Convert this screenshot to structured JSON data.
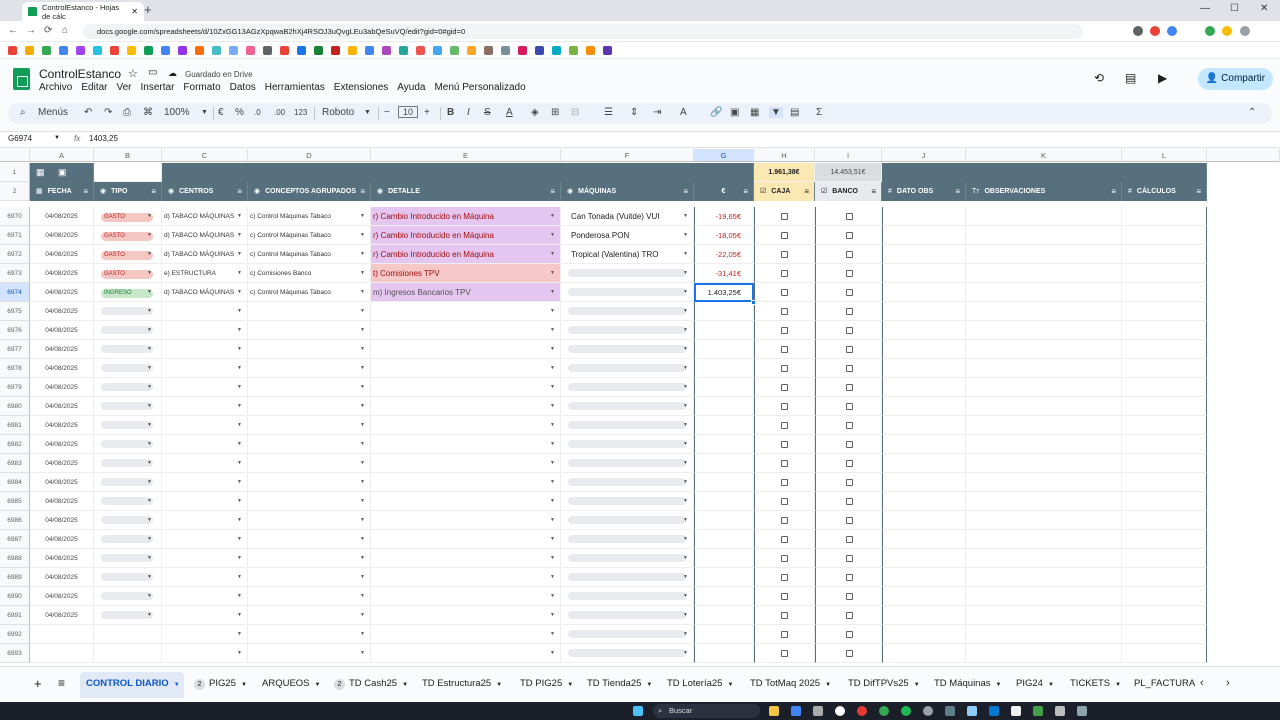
{
  "browser": {
    "tab_title": "ControlEstanco - Hojas de cálc",
    "url": "docs.google.com/spreadsheets/d/10ZxGG13AGzXpqwaB2hXj4RSOJ3uQvgLEu3abQeSuVQ/edit?gid=0#gid=0"
  },
  "app": {
    "title": "ControlEstanco",
    "saved_status": "Guardado en Drive",
    "menus": [
      "Archivo",
      "Editar",
      "Ver",
      "Insertar",
      "Formato",
      "Datos",
      "Herramientas",
      "Extensiones",
      "Ayuda",
      "Menú Personalizado"
    ],
    "share_label": "Compartir"
  },
  "toolbar": {
    "menus_label": "Menús",
    "zoom": "100%",
    "currency": "€",
    "percent": "%",
    "dec_less": ".0",
    "dec_more": ".00",
    "number_format": "123",
    "font": "Roboto",
    "font_size": "10"
  },
  "formula_bar": {
    "name_box": "G6974",
    "fx": "fx",
    "value": "1403,25"
  },
  "columns": [
    "A",
    "B",
    "C",
    "D",
    "E",
    "F",
    "G",
    "H",
    "I",
    "J",
    "K",
    "L"
  ],
  "row1": {
    "caja_total": "1.961,38€",
    "banco_total": "14.453,51€"
  },
  "headers": {
    "fecha": "FECHA",
    "tipo": "TIPO",
    "centros": "CENTROS",
    "conceptos": "CONCEPTOS AGRUPADOS",
    "detalle": "DETALLE",
    "maquinas": "MÁQUINAS",
    "euro": "€",
    "caja": "CAJA",
    "banco": "BANCO",
    "dato_obs": "DATO OBS",
    "observaciones": "OBSERVACIONES",
    "calculos": "CÁLCULOS"
  },
  "rows": [
    {
      "n": "6970",
      "fecha": "04/08/2025",
      "tipo": "GASTO",
      "centro": "d) TABACO MÁQUINAS",
      "concepto": "c) Control Máquinas Tabaco",
      "detalle": "r) Cambio Introducido en Máquina",
      "maquina": "Can Tonada (Vuitde) VUI",
      "importe": "-19,65€"
    },
    {
      "n": "6971",
      "fecha": "04/08/2025",
      "tipo": "GASTO",
      "centro": "d) TABACO MÁQUINAS",
      "concepto": "c) Control Máquinas Tabaco",
      "detalle": "r) Cambio Introducido en Máquina",
      "maquina": "Ponderosa PON",
      "importe": "-18,05€"
    },
    {
      "n": "6972",
      "fecha": "04/08/2025",
      "tipo": "GASTO",
      "centro": "d) TABACO MÁQUINAS",
      "concepto": "c) Control Máquinas Tabaco",
      "detalle": "r) Cambio Introducido en Máquina",
      "maquina": "Tropical (Valentina) TRO",
      "importe": "-22,05€"
    },
    {
      "n": "6973",
      "fecha": "04/08/2025",
      "tipo": "GASTO",
      "centro": "e) ESTRUCTURA",
      "concepto": "c) Comisiones Banco",
      "detalle": "t) Comisiones TPV",
      "maquina": "",
      "importe": "-31,41€"
    },
    {
      "n": "6974",
      "fecha": "04/08/2025",
      "tipo": "INGRESO",
      "centro": "d) TABACO MÁQUINAS",
      "concepto": "c) Control Máquinas Tabaco",
      "detalle": "m) Ingresos Bancarios TPV",
      "maquina": "",
      "importe": "1.403,25€"
    },
    {
      "n": "6975",
      "fecha": "04/08/2025"
    },
    {
      "n": "6976",
      "fecha": "04/08/2025"
    },
    {
      "n": "6977",
      "fecha": "04/08/2025"
    },
    {
      "n": "6978",
      "fecha": "04/08/2025"
    },
    {
      "n": "6979",
      "fecha": "04/08/2025"
    },
    {
      "n": "6980",
      "fecha": "04/08/2025"
    },
    {
      "n": "6981",
      "fecha": "04/08/2025"
    },
    {
      "n": "6982",
      "fecha": "04/08/2025"
    },
    {
      "n": "6983",
      "fecha": "04/08/2025"
    },
    {
      "n": "6984",
      "fecha": "04/08/2025"
    },
    {
      "n": "6985",
      "fecha": "04/08/2025"
    },
    {
      "n": "6986",
      "fecha": "04/08/2025"
    },
    {
      "n": "6987",
      "fecha": "04/08/2025"
    },
    {
      "n": "6988",
      "fecha": "04/08/2025"
    },
    {
      "n": "6989",
      "fecha": "04/08/2025"
    },
    {
      "n": "6990",
      "fecha": "04/08/2025"
    },
    {
      "n": "6991",
      "fecha": "04/08/2025"
    },
    {
      "n": "6992",
      "fecha": ""
    },
    {
      "n": "6993",
      "fecha": ""
    }
  ],
  "sheet_tabs": [
    {
      "label": "CONTROL DIARIO",
      "badge": ""
    },
    {
      "label": "PIG25",
      "badge": "2"
    },
    {
      "label": "ARQUEOS",
      "badge": ""
    },
    {
      "label": "TD Cash25",
      "badge": "2"
    },
    {
      "label": "TD Estructura25",
      "badge": ""
    },
    {
      "label": "TD PIG25",
      "badge": ""
    },
    {
      "label": "TD Tienda25",
      "badge": ""
    },
    {
      "label": "TD Lotería25",
      "badge": ""
    },
    {
      "label": "TD TotMaq 2025",
      "badge": ""
    },
    {
      "label": "TD DifTPVs25",
      "badge": ""
    },
    {
      "label": "TD Máquinas",
      "badge": ""
    },
    {
      "label": "PIG24",
      "badge": ""
    },
    {
      "label": "TICKETS",
      "badge": ""
    },
    {
      "label": "PL_FACTURA",
      "badge": ""
    }
  ],
  "taskbar": {
    "search_label": "Buscar"
  },
  "colors": {
    "header_bg": "#56707d",
    "gasto_chip": "#f4c7c3",
    "gasto_text": "#c5221f",
    "ingreso_chip": "#c8e6c9",
    "ingreso_text": "#188038",
    "detalle_purple": "#e4c6f0",
    "detalle_pink": "#f7c8c8",
    "caja_yellow": "#fce8b2",
    "negative": "#c5221f"
  }
}
